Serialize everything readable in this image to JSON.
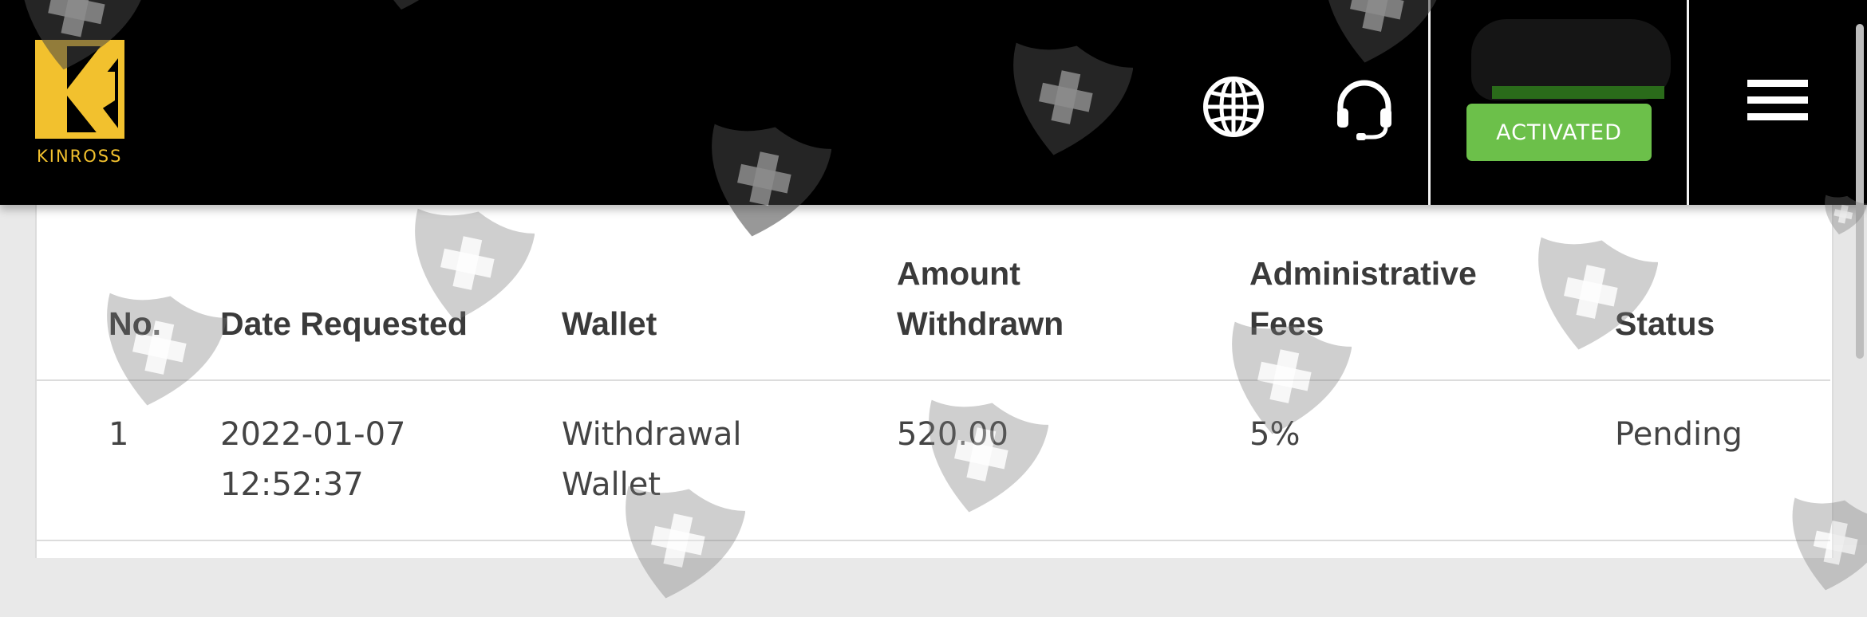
{
  "header": {
    "brand_name": "KINROSS",
    "activated_label": "ACTIVATED",
    "icons": [
      "globe-icon",
      "headset-icon",
      "hamburger-menu-icon"
    ],
    "colors": {
      "background": "#000000",
      "logo": "#f2c12e",
      "activated": "#6cc04a"
    }
  },
  "table": {
    "columns": {
      "no": "No.",
      "date": "Date Requested",
      "wallet": "Wallet",
      "amount_line1": "Amount",
      "amount_line2": "Withdrawn",
      "fees_line1": "Administrative",
      "fees_line2": "Fees",
      "status": "Status"
    },
    "rows": [
      {
        "no": "1",
        "date_line1": "2022-01-07",
        "date_line2": "12:52:37",
        "wallet_line1": "Withdrawal",
        "wallet_line2": "Wallet",
        "amount": "520.00",
        "fees": "5%",
        "status": "Pending"
      }
    ]
  }
}
